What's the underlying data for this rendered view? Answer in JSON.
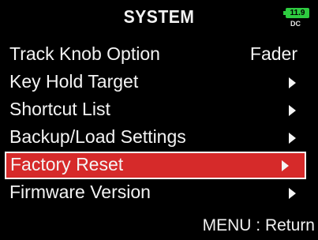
{
  "header": {
    "title": "SYSTEM",
    "battery_level": "11.9",
    "power_source": "DC",
    "battery_color": "#2ecc40"
  },
  "menu": {
    "items": [
      {
        "label": "Track Knob Option",
        "value": "Fader",
        "has_arrow": false,
        "selected": false
      },
      {
        "label": "Key Hold Target",
        "value": "",
        "has_arrow": true,
        "selected": false
      },
      {
        "label": "Shortcut List",
        "value": "",
        "has_arrow": true,
        "selected": false
      },
      {
        "label": "Backup/Load Settings",
        "value": "",
        "has_arrow": true,
        "selected": false
      },
      {
        "label": "Factory Reset",
        "value": "",
        "has_arrow": true,
        "selected": true
      },
      {
        "label": "Firmware Version",
        "value": "",
        "has_arrow": true,
        "selected": false
      }
    ],
    "selected_color": "#d62a2a"
  },
  "footer": {
    "hint": "MENU : Return"
  }
}
